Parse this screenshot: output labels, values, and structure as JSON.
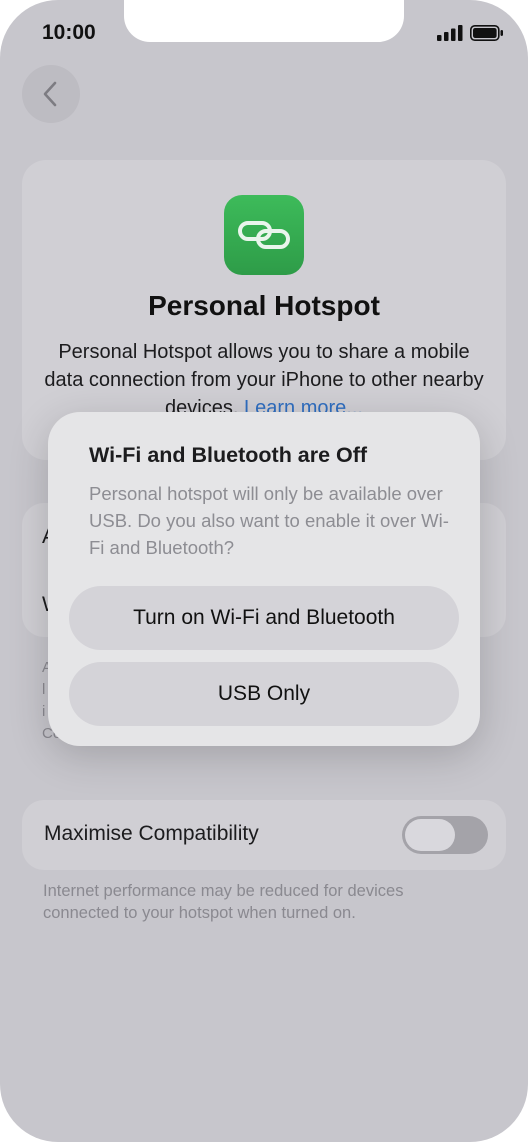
{
  "status_bar": {
    "time": "10:00"
  },
  "page": {
    "title": "Personal Hotspot",
    "description": "Personal Hotspot allows you to share a mobile data connection from your iPhone to other nearby devices.",
    "learn_more": "Learn more..."
  },
  "background_rows": {
    "row1_initial": "A",
    "row2_initial": "W",
    "footer_fragments": [
      "A",
      "l",
      "i",
      "Co"
    ]
  },
  "compatibility": {
    "label": "Maximise Compatibility",
    "toggle_on": false,
    "footer": "Internet performance may be reduced for devices connected to your hotspot when turned on."
  },
  "dialog": {
    "title": "Wi-Fi and Bluetooth are Off",
    "message": "Personal hotspot will only be available over USB. Do you also want to enable it over Wi-Fi and Bluetooth?",
    "primary_button": "Turn on Wi-Fi and Bluetooth",
    "secondary_button": "USB Only"
  },
  "colors": {
    "app_icon": "#34a853",
    "link": "#2f6ec0",
    "overlay_background": "#c7c6cc",
    "dialog_background": "#e5e5e7"
  }
}
